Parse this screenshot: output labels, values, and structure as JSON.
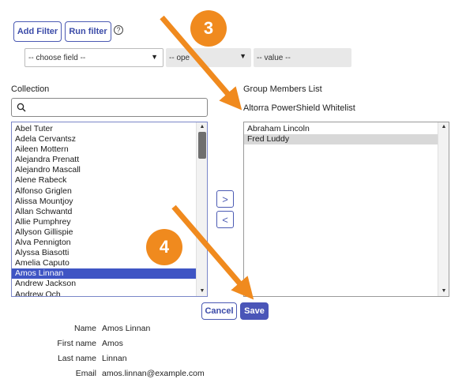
{
  "filter": {
    "add_filter_label": "Add Filter",
    "run_filter_label": "Run filter",
    "help_glyph": "?",
    "field_select_value": "-- choose field --",
    "operator_select_value": "-- ope",
    "value_select_value": "-- value --"
  },
  "collection": {
    "heading": "Collection",
    "search_value": "",
    "items": [
      "Abel Tuter",
      "Adela Cervantsz",
      "Aileen Mottern",
      "Alejandra Prenatt",
      "Alejandro Mascall",
      "Alene Rabeck",
      "Alfonso Griglen",
      "Alissa Mountjoy",
      "Allan Schwantd",
      "Allie Pumphrey",
      "Allyson Gillispie",
      "Alva Pennigton",
      "Alyssa Biasotti",
      "Amelia Caputo",
      "Amos Linnan",
      "Andrew Jackson",
      "Andrew Och"
    ],
    "selected": "Amos Linnan"
  },
  "members": {
    "heading": "Group Members List",
    "group_name": "Altorra PowerShield Whitelist",
    "items": [
      "Abraham Lincoln",
      "Fred Luddy"
    ],
    "highlighted": "Fred Luddy"
  },
  "actions": {
    "add_glyph": ">",
    "remove_glyph": "<",
    "cancel_label": "Cancel",
    "save_label": "Save"
  },
  "annotations": {
    "step_3": "3",
    "step_4": "4",
    "color": "#f08a1e"
  },
  "details": [
    {
      "key": "Name",
      "value": "Amos Linnan"
    },
    {
      "key": "First name",
      "value": "Amos"
    },
    {
      "key": "Last name",
      "value": "Linnan"
    },
    {
      "key": "Email",
      "value": "amos.linnan@example.com"
    }
  ]
}
